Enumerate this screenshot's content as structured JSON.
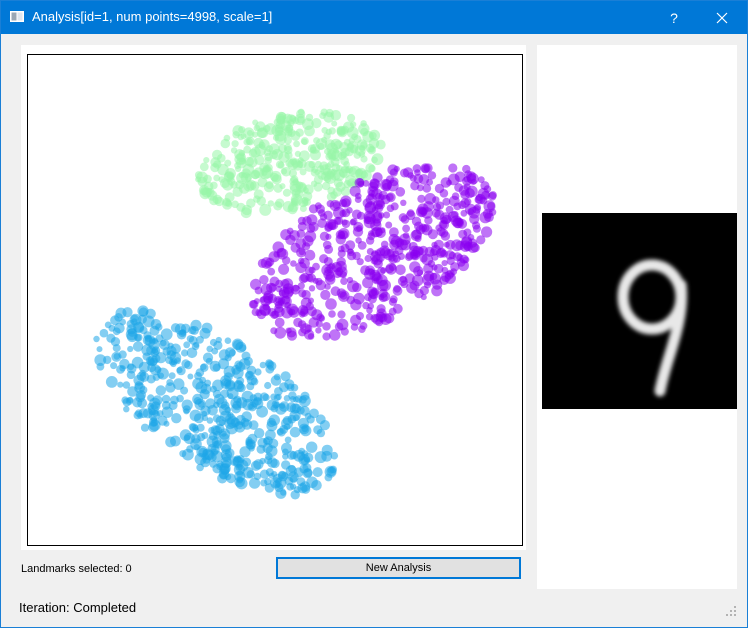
{
  "window": {
    "title": "Analysis[id=1, num points=4998, scale=1]",
    "help_label": "?"
  },
  "scatter": {
    "clusters": [
      {
        "color": "#98f5a8",
        "center": [
          0.53,
          0.22
        ],
        "radius": [
          0.19,
          0.1
        ],
        "angle": -12,
        "count": 340
      },
      {
        "color": "#8a00f0",
        "center": [
          0.7,
          0.4
        ],
        "radius": [
          0.27,
          0.14
        ],
        "angle": -29,
        "count": 560
      },
      {
        "color": "#1ea6e8",
        "center": [
          0.38,
          0.71
        ],
        "radius": [
          0.28,
          0.13
        ],
        "angle": 33,
        "count": 520
      }
    ]
  },
  "controls": {
    "landmarks_text": "Landmarks selected: 0",
    "new_analysis_label": "New Analysis"
  },
  "status": {
    "text": "Iteration: Completed"
  }
}
